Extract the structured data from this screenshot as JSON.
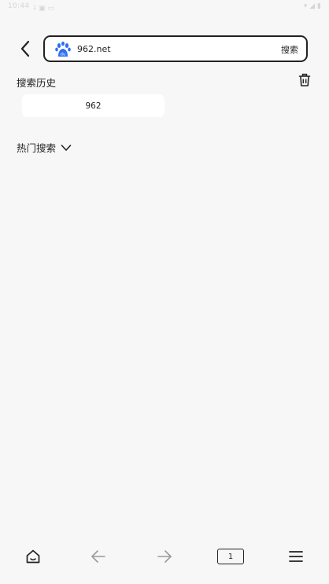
{
  "status_bar": {
    "time": "10:44",
    "extra": "⸸ ▣ ▭",
    "right_icons": "▾ ◢ ▮"
  },
  "search": {
    "query": "962.net",
    "submit_label": "搜索",
    "logo_icon": "baidu-paw-logo"
  },
  "history": {
    "title": "搜索历史",
    "items": [
      "962"
    ]
  },
  "hot": {
    "title": "热门搜索"
  },
  "bottom_nav": {
    "tab_count": "1"
  },
  "colors": {
    "background": "#f7f7f7",
    "accent_blue": "#2f6ff5",
    "chip_bg": "#ffffff"
  }
}
